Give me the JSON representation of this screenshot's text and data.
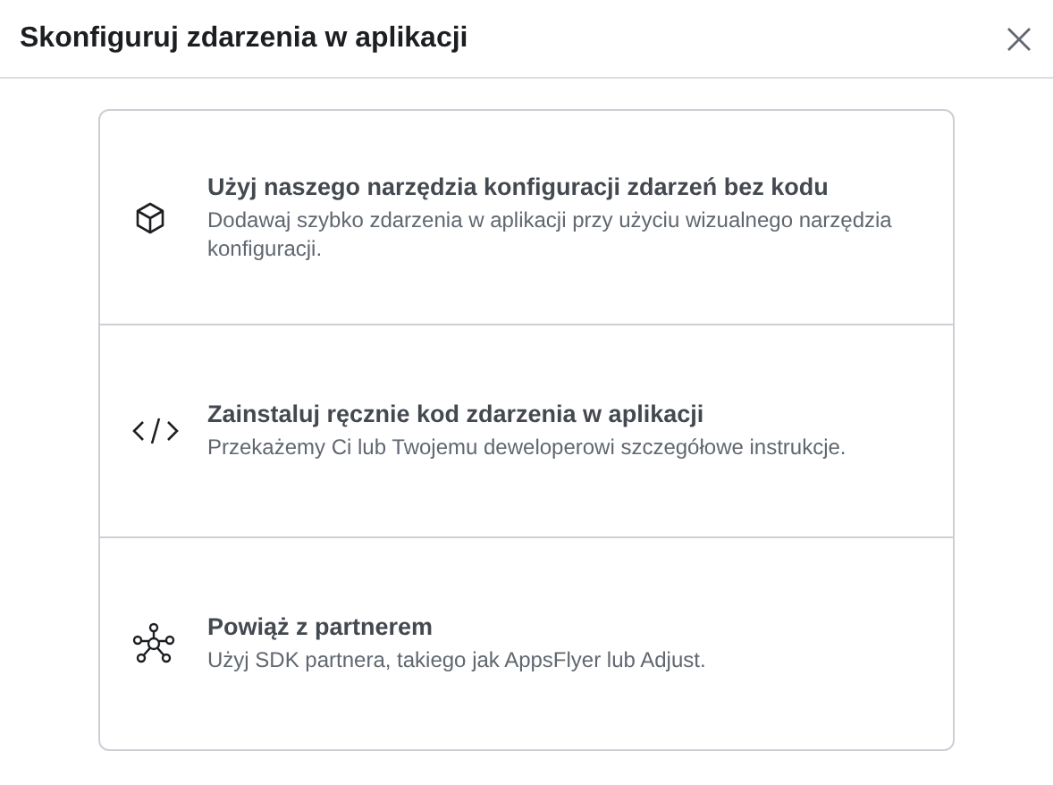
{
  "dialog": {
    "title": "Skonfiguruj zdarzenia w aplikacji"
  },
  "options": [
    {
      "kind": "cube",
      "title": "Użyj naszego narzędzia konfiguracji zdarzeń bez kodu",
      "description": "Dodawaj szybko zdarzenia w aplikacji przy użyciu wizualnego narzędzia konfiguracji."
    },
    {
      "kind": "code",
      "title": "Zainstaluj ręcznie kod zdarzenia w aplikacji",
      "description": "Przekażemy Ci lub Twojemu deweloperowi szczegółowe instrukcje."
    },
    {
      "kind": "network",
      "title": "Powiąż z partnerem",
      "description": "Użyj SDK partnera, takiego jak AppsFlyer lub Adjust."
    }
  ]
}
